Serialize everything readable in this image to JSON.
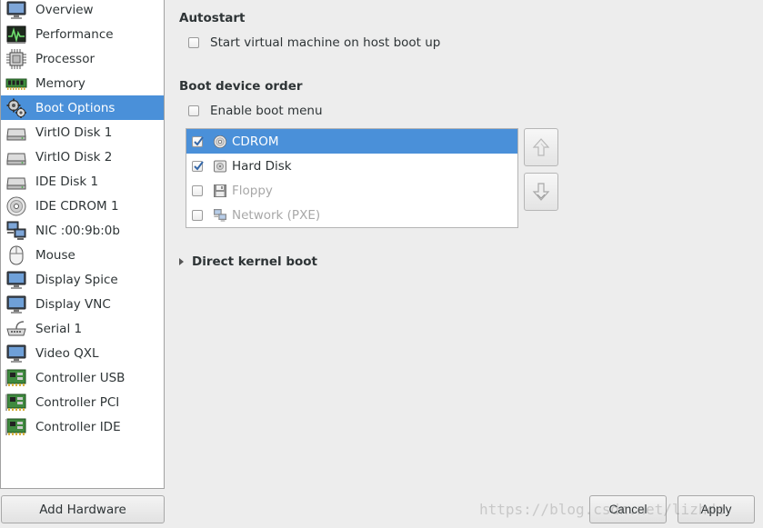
{
  "sidebar": {
    "items": [
      {
        "label": "Overview",
        "icon": "overview-icon"
      },
      {
        "label": "Performance",
        "icon": "performance-icon"
      },
      {
        "label": "Processor",
        "icon": "processor-icon"
      },
      {
        "label": "Memory",
        "icon": "memory-icon"
      },
      {
        "label": "Boot Options",
        "icon": "boot-options-icon",
        "selected": true
      },
      {
        "label": "VirtIO Disk 1",
        "icon": "disk-icon"
      },
      {
        "label": "VirtIO Disk 2",
        "icon": "disk-icon"
      },
      {
        "label": "IDE Disk 1",
        "icon": "disk-icon"
      },
      {
        "label": "IDE CDROM 1",
        "icon": "cdrom-icon"
      },
      {
        "label": "NIC :00:9b:0b",
        "icon": "network-icon"
      },
      {
        "label": "Mouse",
        "icon": "mouse-icon"
      },
      {
        "label": "Display Spice",
        "icon": "monitor-icon"
      },
      {
        "label": "Display VNC",
        "icon": "monitor-icon"
      },
      {
        "label": "Serial 1",
        "icon": "serial-icon"
      },
      {
        "label": "Video QXL",
        "icon": "monitor-icon"
      },
      {
        "label": "Controller USB",
        "icon": "controller-icon"
      },
      {
        "label": "Controller PCI",
        "icon": "controller-icon"
      },
      {
        "label": "Controller IDE",
        "icon": "controller-icon"
      }
    ],
    "add_hardware_label": "Add Hardware"
  },
  "autostart": {
    "heading": "Autostart",
    "checkbox_label": "Start virtual machine on host boot up",
    "checked": false
  },
  "boot_order": {
    "heading": "Boot device order",
    "enable_menu_label": "Enable boot menu",
    "enable_menu_checked": false,
    "devices": [
      {
        "label": "CDROM",
        "checked": true,
        "selected": true,
        "enabled": true,
        "icon": "cdrom-icon"
      },
      {
        "label": "Hard Disk",
        "checked": true,
        "selected": false,
        "enabled": true,
        "icon": "hard-disk-icon"
      },
      {
        "label": "Floppy",
        "checked": false,
        "selected": false,
        "enabled": false,
        "icon": "floppy-icon"
      },
      {
        "label": "Network (PXE)",
        "checked": false,
        "selected": false,
        "enabled": false,
        "icon": "network-icon"
      }
    ]
  },
  "kernel_boot": {
    "label": "Direct kernel boot",
    "expanded": false
  },
  "footer": {
    "cancel_label": "Cancel",
    "apply_label": "Apply"
  },
  "watermark": "https://blog.csdn.net/lizhde",
  "colors": {
    "selection": "#4a90d9",
    "window_bg": "#ededed"
  }
}
